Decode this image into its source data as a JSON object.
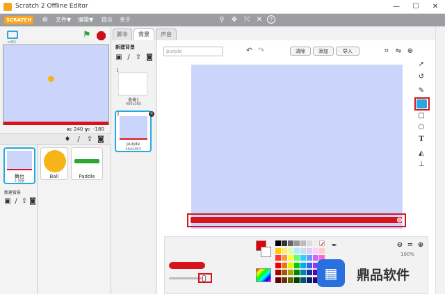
{
  "window": {
    "title": "Scratch 2 Offline Editor",
    "controls": [
      "—",
      "☐",
      "✕"
    ]
  },
  "menu": {
    "logo": "SCRATCH",
    "items": [
      "文件▼",
      "编辑▼",
      "提示",
      "关于"
    ]
  },
  "stage": {
    "version": "v461",
    "coord_x_label": "x:",
    "coord_x": "240",
    "coord_y_label": "y:",
    "coord_y": "-180"
  },
  "sprites": [
    {
      "name": "舞台",
      "sub": "2 背景"
    },
    {
      "name": "Ball"
    },
    {
      "name": "Paddle"
    }
  ],
  "new_backdrop_label": "新建背景",
  "tabs": [
    "脚本",
    "背景",
    "声音"
  ],
  "backdrops_panel": {
    "title": "新建背景",
    "items": [
      {
        "index": "1",
        "name": "背景1",
        "size": "480x360"
      },
      {
        "index": "2",
        "name": "purple",
        "size": "494x383"
      }
    ]
  },
  "editor": {
    "name_value": "purple",
    "buttons": [
      "清除",
      "添加",
      "导入"
    ],
    "zoom": "100%"
  },
  "colors": {
    "accent": "#d8131b",
    "stage_bg": "#cbd5fb",
    "menu_bg": "#9c9ea2",
    "selected_blue": "#25a9e0"
  },
  "watermark": {
    "text": "鼎品软件"
  }
}
